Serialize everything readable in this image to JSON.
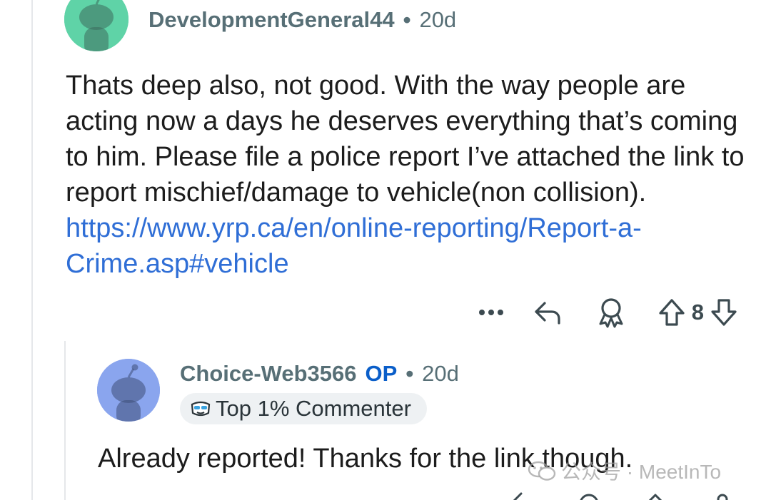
{
  "comment": {
    "username": "DevelopmentGeneral44",
    "separator": "•",
    "age": "20d",
    "avatar_color": "#5fd3a7",
    "body_text": "Thats deep also, not good.  With the way people are acting now a days he deserves everything that’s coming to him. Please file a police report I’ve attached the link to report mischief/damage to vehicle(non collision). ",
    "link_text": "https://www.yrp.ca/en/online-reporting/Report-a-Crime.asp#vehicle",
    "actions": {
      "more_icon": "more-horizontal-icon",
      "reply_icon": "reply-icon",
      "award_icon": "award-icon",
      "upvote_icon": "upvote-icon",
      "vote_count": "8",
      "downvote_icon": "downvote-icon"
    }
  },
  "reply": {
    "username": "Choice-Web3566",
    "op_label": "OP",
    "separator": "•",
    "age": "20d",
    "avatar_color": "#8aa5ee",
    "flair_icon": "sunglasses-icon",
    "flair_text": "Top 1% Commenter",
    "body_text": "Already reported! Thanks for the link though."
  },
  "watermark": {
    "text": "公众号 · MeetInTo"
  },
  "colors": {
    "link": "#2f6ed6",
    "meta": "#576f76",
    "op": "#0a5ec9",
    "thread_line": "#e5e7ea"
  }
}
